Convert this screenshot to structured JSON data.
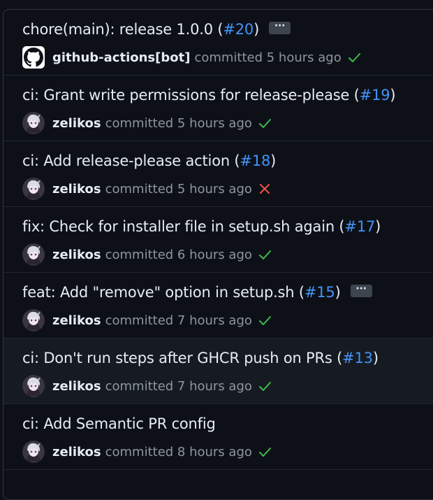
{
  "commits": [
    {
      "title": "chore(main): release 1.0.0 (",
      "pr": "#20",
      "suffix": ")",
      "has_more": true,
      "author": "github-actions[bot]",
      "committed_text": "committed 5 hours ago",
      "status": "success",
      "avatar": "github-icon"
    },
    {
      "title": "ci: Grant write permissions for release-please (",
      "pr": "#19",
      "suffix": ")",
      "has_more": false,
      "author": "zelikos",
      "committed_text": "committed 5 hours ago",
      "status": "success",
      "avatar": "user-avatar"
    },
    {
      "title": "ci: Add release-please action (",
      "pr": "#18",
      "suffix": ")",
      "has_more": false,
      "author": "zelikos",
      "committed_text": "committed 5 hours ago",
      "status": "failure",
      "avatar": "user-avatar"
    },
    {
      "title": "fix: Check for installer file in setup.sh again (",
      "pr": "#17",
      "suffix": ")",
      "has_more": false,
      "author": "zelikos",
      "committed_text": "committed 6 hours ago",
      "status": "success",
      "avatar": "user-avatar"
    },
    {
      "title": "feat: Add \"remove\" option in setup.sh (",
      "pr": "#15",
      "suffix": ")",
      "has_more": true,
      "author": "zelikos",
      "committed_text": "committed 7 hours ago",
      "status": "success",
      "avatar": "user-avatar"
    },
    {
      "title": "ci: Don't run steps after GHCR push on PRs (",
      "pr": "#13",
      "suffix": ")",
      "has_more": false,
      "author": "zelikos",
      "committed_text": "committed 7 hours ago",
      "status": "success",
      "avatar": "user-avatar"
    },
    {
      "title": "ci: Add Semantic PR config",
      "pr": "",
      "suffix": "",
      "has_more": false,
      "author": "zelikos",
      "committed_text": "committed 8 hours ago",
      "status": "success",
      "avatar": "user-avatar"
    }
  ],
  "ellipsis_label": "···",
  "colors": {
    "background": "#0d1117",
    "highlight_row": "#161b22",
    "link": "#4493f8",
    "success": "#3fb950",
    "failure": "#f85149",
    "muted_text": "#8d96a0"
  }
}
